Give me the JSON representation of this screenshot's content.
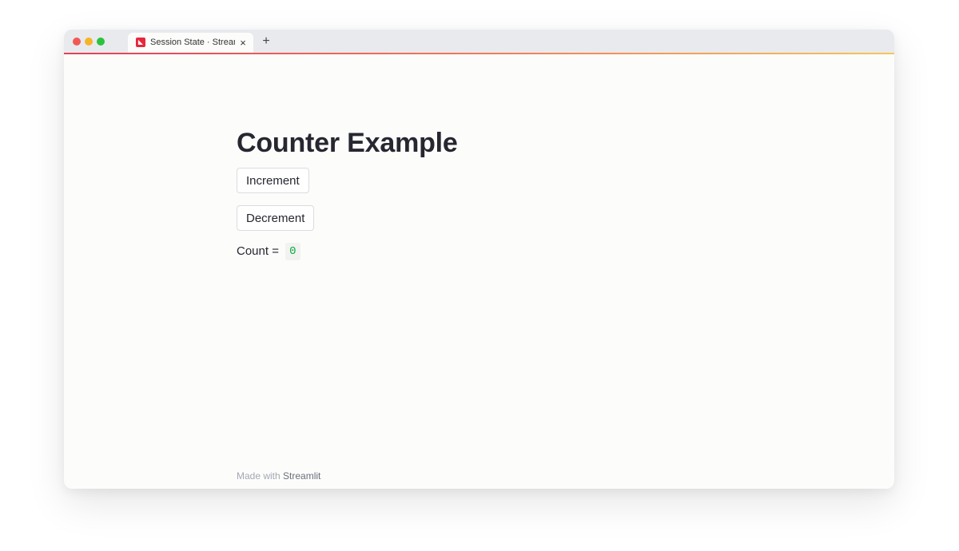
{
  "browser": {
    "tab_title": "Session State · Streamlit",
    "tab_close": "×",
    "new_tab": "+"
  },
  "main": {
    "title": "Counter Example",
    "increment_label": "Increment",
    "decrement_label": "Decrement",
    "count_label": "Count =",
    "count_value": "0"
  },
  "footer": {
    "prefix": "Made with",
    "brand": "Streamlit"
  },
  "colors": {
    "accent_gradient": [
      "#e0405a",
      "#f5c65a"
    ],
    "code_value": "#09ab3b",
    "favicon": "#e8273b"
  },
  "icons": {
    "favicon": "streamlit-logo-icon",
    "tab_close": "close-icon",
    "new_tab": "plus-icon"
  }
}
